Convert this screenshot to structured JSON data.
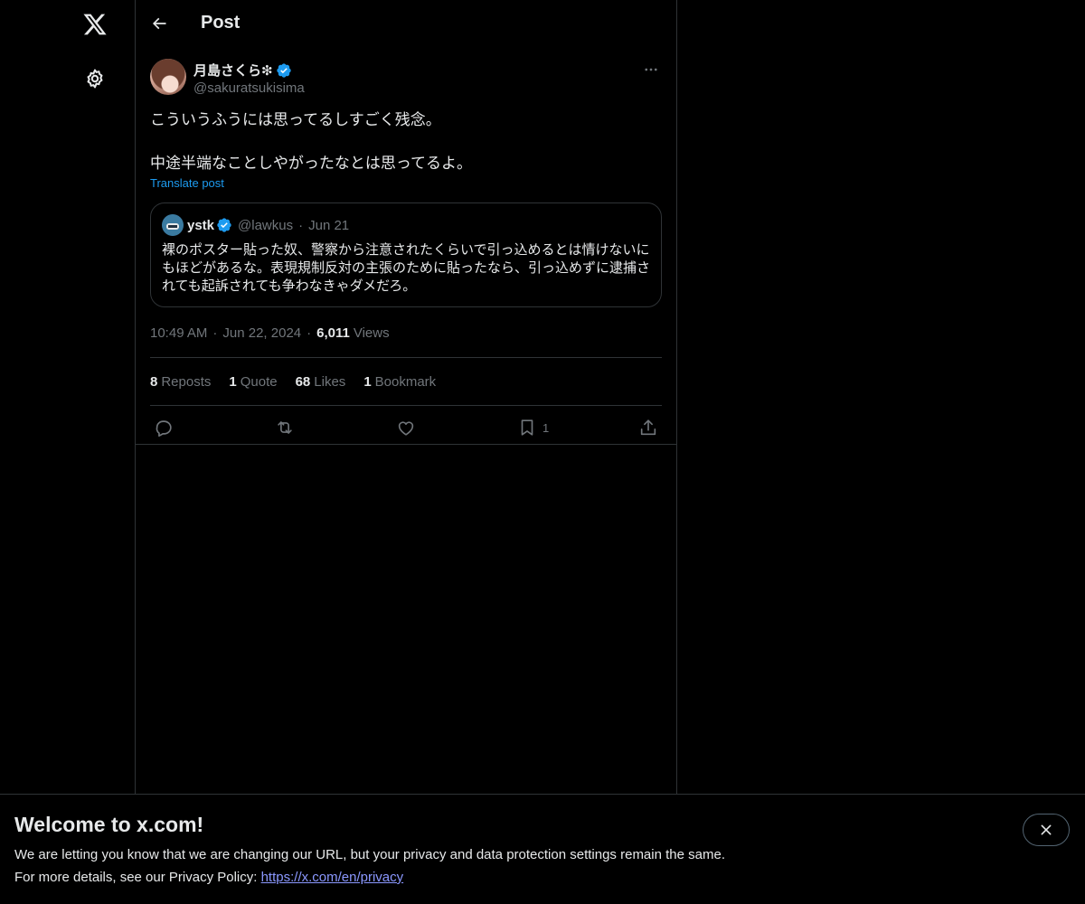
{
  "header": {
    "title": "Post"
  },
  "post": {
    "author_name": "月島さくら❇",
    "author_handle": "@sakuratsukisima",
    "text": "こういうふうには思ってるしすごく残念。\n\n中途半端なことしやがったなとは思ってるよ。",
    "translate_label": "Translate post",
    "time": "10:49 AM",
    "date": "Jun 22, 2024",
    "views_count": "6,011",
    "views_label": "Views"
  },
  "quote": {
    "name": "ystk",
    "handle": "@lawkus",
    "dot": "·",
    "date": "Jun 21",
    "text": "裸のポスター貼った奴、警察から注意されたくらいで引っ込めるとは情けないにもほどがあるな。表現規制反対の主張のために貼ったなら、引っ込めずに逮捕されても起訴されても争わなきゃダメだろ。"
  },
  "stats": [
    {
      "num": "8",
      "label": "Reposts"
    },
    {
      "num": "1",
      "label": "Quote"
    },
    {
      "num": "68",
      "label": "Likes"
    },
    {
      "num": "1",
      "label": "Bookmark"
    }
  ],
  "actions": {
    "bookmark_count": "1"
  },
  "meta": {
    "separator": "·"
  },
  "banner": {
    "title": "Welcome to x.com!",
    "line1": "We are letting you know that we are changing our URL, but your privacy and data protection settings remain the same.",
    "line2_prefix": "For more details, see our Privacy Policy: ",
    "link": "https://x.com/en/privacy"
  },
  "colors": {
    "background": "#000000",
    "text": "#e7e9ea",
    "muted": "#71767b",
    "accent": "#1d9bf0",
    "border": "#2f3336",
    "link_in_banner": "#8b98ff"
  },
  "icons": {
    "logo": "x-logo-icon",
    "settings": "gear-icon",
    "back": "arrow-left-icon",
    "more": "more-horizontal-icon",
    "verified": "verified-badge-icon",
    "reply": "reply-icon",
    "repost": "repost-icon",
    "like": "heart-icon",
    "bookmark": "bookmark-icon",
    "share": "share-icon",
    "close": "close-icon"
  }
}
